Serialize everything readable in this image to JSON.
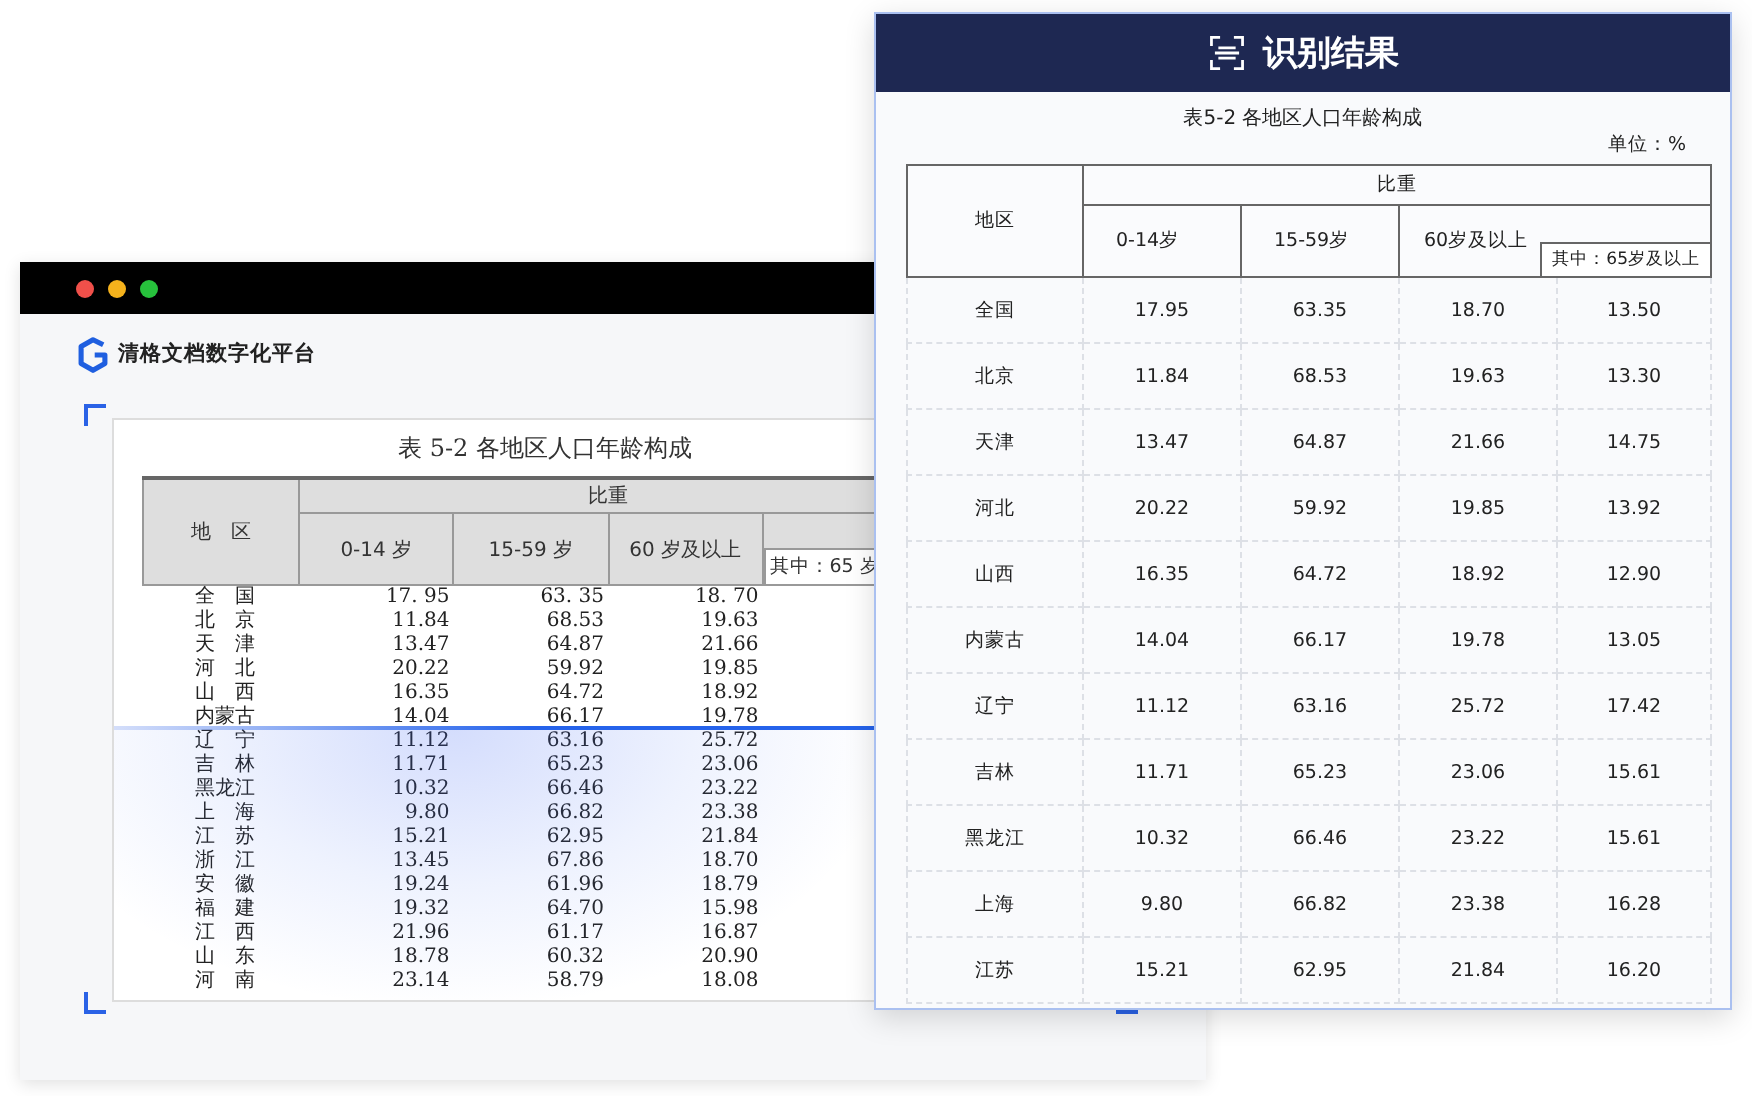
{
  "app_window": {
    "brand": "清格文档数字化平台",
    "document": {
      "title": "表 5-2  各地区人口年龄构成",
      "header": {
        "region": "地　区",
        "group": "比重",
        "columns": [
          "0-14 岁",
          "15-59 岁",
          "60 岁及以上"
        ],
        "sub_column": "其中：65 岁"
      },
      "rows": [
        {
          "region": "全　国",
          "values": [
            "17. 95",
            "63. 35",
            "18. 70"
          ]
        },
        {
          "region": "北　京",
          "values": [
            "11.84",
            "68.53",
            "19.63"
          ]
        },
        {
          "region": "天　津",
          "values": [
            "13.47",
            "64.87",
            "21.66"
          ]
        },
        {
          "region": "河　北",
          "values": [
            "20.22",
            "59.92",
            "19.85"
          ]
        },
        {
          "region": "山　西",
          "values": [
            "16.35",
            "64.72",
            "18.92"
          ]
        },
        {
          "region": "内蒙古",
          "values": [
            "14.04",
            "66.17",
            "19.78"
          ]
        },
        {
          "region": "辽　宁",
          "values": [
            "11.12",
            "63.16",
            "25.72"
          ]
        },
        {
          "region": "吉　林",
          "values": [
            "11.71",
            "65.23",
            "23.06"
          ]
        },
        {
          "region": "黑龙江",
          "values": [
            "10.32",
            "66.46",
            "23.22"
          ]
        },
        {
          "region": "上　海",
          "values": [
            "9.80",
            "66.82",
            "23.38"
          ]
        },
        {
          "region": "江　苏",
          "values": [
            "15.21",
            "62.95",
            "21.84"
          ]
        },
        {
          "region": "浙　江",
          "values": [
            "13.45",
            "67.86",
            "18.70"
          ]
        },
        {
          "region": "安　徽",
          "values": [
            "19.24",
            "61.96",
            "18.79"
          ]
        },
        {
          "region": "福　建",
          "values": [
            "19.32",
            "64.70",
            "15.98"
          ]
        },
        {
          "region": "江　西",
          "values": [
            "21.96",
            "61.17",
            "16.87"
          ]
        },
        {
          "region": "山　东",
          "values": [
            "18.78",
            "60.32",
            "20.90"
          ]
        },
        {
          "region": "河　南",
          "values": [
            "23.14",
            "58.79",
            "18.08"
          ]
        }
      ]
    }
  },
  "result_panel": {
    "title": "识别结果",
    "table_title": "表5-2 各地区人口年龄构成",
    "unit": "单位：%",
    "header": {
      "region": "地区",
      "group": "比重",
      "columns": [
        "0-14岁",
        "15-59岁",
        "60岁及以上"
      ],
      "sub_column": "其中：65岁及以上"
    },
    "rows": [
      {
        "region": "全国",
        "values": [
          "17.95",
          "63.35",
          "18.70",
          "13.50"
        ]
      },
      {
        "region": "北京",
        "values": [
          "11.84",
          "68.53",
          "19.63",
          "13.30"
        ]
      },
      {
        "region": "天津",
        "values": [
          "13.47",
          "64.87",
          "21.66",
          "14.75"
        ]
      },
      {
        "region": "河北",
        "values": [
          "20.22",
          "59.92",
          "19.85",
          "13.92"
        ]
      },
      {
        "region": "山西",
        "values": [
          "16.35",
          "64.72",
          "18.92",
          "12.90"
        ]
      },
      {
        "region": "内蒙古",
        "values": [
          "14.04",
          "66.17",
          "19.78",
          "13.05"
        ]
      },
      {
        "region": "辽宁",
        "values": [
          "11.12",
          "63.16",
          "25.72",
          "17.42"
        ]
      },
      {
        "region": "吉林",
        "values": [
          "11.71",
          "65.23",
          "23.06",
          "15.61"
        ]
      },
      {
        "region": "黑龙江",
        "values": [
          "10.32",
          "66.46",
          "23.22",
          "15.61"
        ]
      },
      {
        "region": "上海",
        "values": [
          "9.80",
          "66.82",
          "23.38",
          "16.28"
        ]
      },
      {
        "region": "江苏",
        "values": [
          "15.21",
          "62.95",
          "21.84",
          "16.20"
        ]
      }
    ]
  }
}
